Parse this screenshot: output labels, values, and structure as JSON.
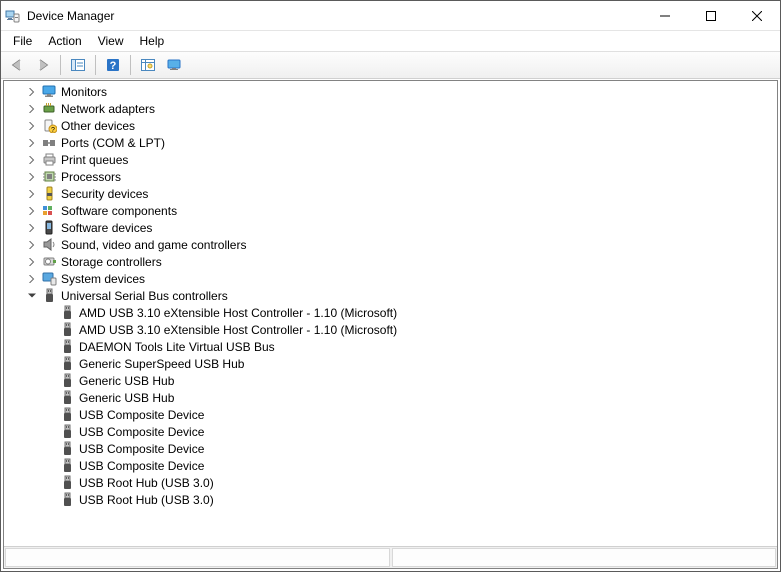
{
  "window": {
    "title": "Device Manager"
  },
  "menu": {
    "file": "File",
    "action": "Action",
    "view": "View",
    "help": "Help"
  },
  "tree": {
    "collapsed_categories": [
      {
        "label": "Monitors",
        "icon": "monitor-icon"
      },
      {
        "label": "Network adapters",
        "icon": "network-icon"
      },
      {
        "label": "Other devices",
        "icon": "other-icon"
      },
      {
        "label": "Ports (COM & LPT)",
        "icon": "port-icon"
      },
      {
        "label": "Print queues",
        "icon": "printer-icon"
      },
      {
        "label": "Processors",
        "icon": "cpu-icon"
      },
      {
        "label": "Security devices",
        "icon": "security-icon"
      },
      {
        "label": "Software components",
        "icon": "swcomp-icon"
      },
      {
        "label": "Software devices",
        "icon": "swdev-icon"
      },
      {
        "label": "Sound, video and game controllers",
        "icon": "sound-icon"
      },
      {
        "label": "Storage controllers",
        "icon": "storage-icon"
      },
      {
        "label": "System devices",
        "icon": "system-icon"
      }
    ],
    "expanded_category": {
      "label": "Universal Serial Bus controllers",
      "icon": "usb-icon",
      "children": [
        "AMD USB 3.10 eXtensible Host Controller - 1.10 (Microsoft)",
        "AMD USB 3.10 eXtensible Host Controller - 1.10 (Microsoft)",
        "DAEMON Tools Lite Virtual USB Bus",
        "Generic SuperSpeed USB Hub",
        "Generic USB Hub",
        "Generic USB Hub",
        "USB Composite Device",
        "USB Composite Device",
        "USB Composite Device",
        "USB Composite Device",
        "USB Root Hub (USB 3.0)",
        "USB Root Hub (USB 3.0)"
      ]
    }
  }
}
